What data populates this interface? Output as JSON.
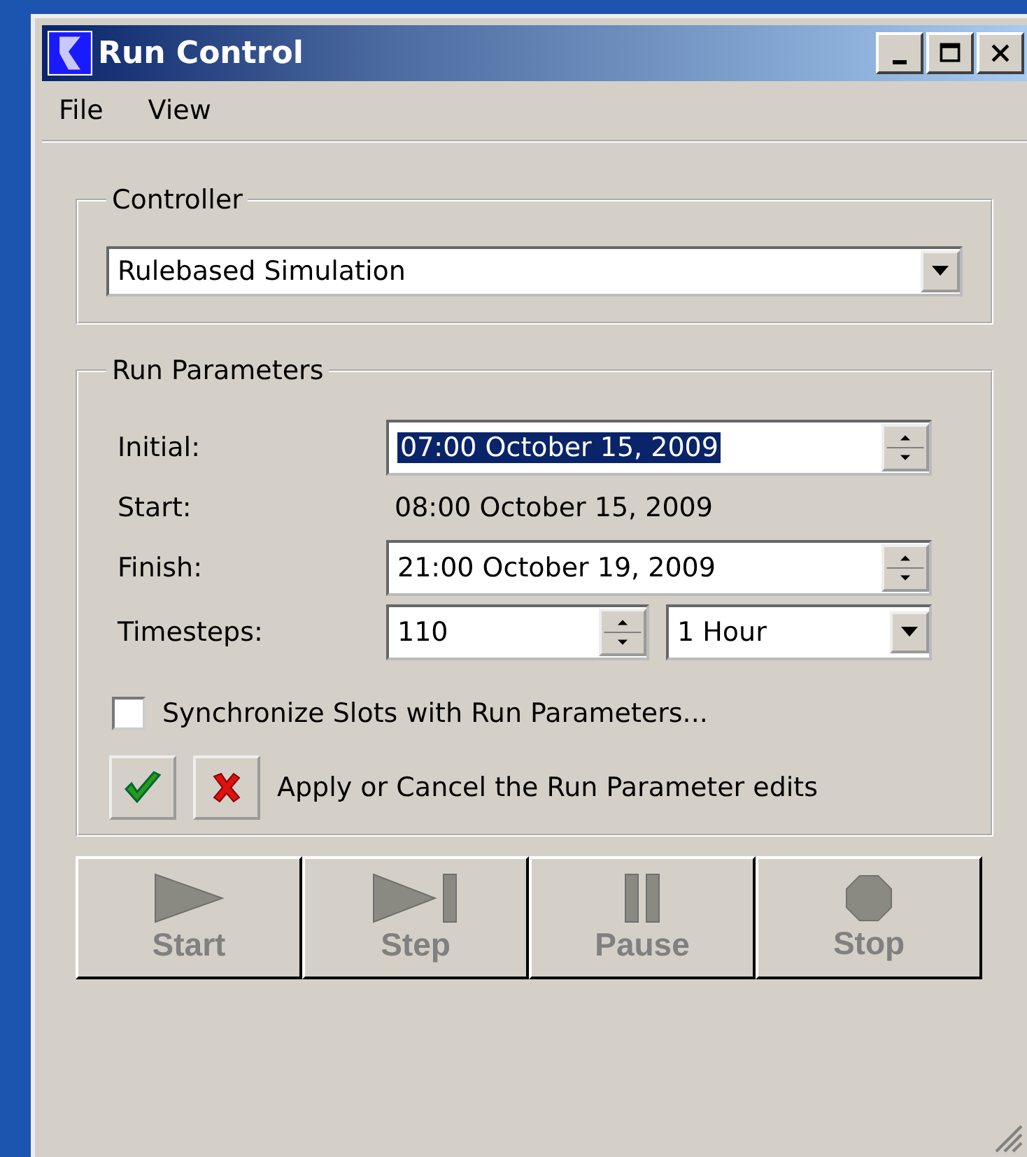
{
  "window": {
    "title": "Run Control"
  },
  "menu": [
    "File",
    "View"
  ],
  "controller": {
    "label": "Controller",
    "value": "Rulebased Simulation"
  },
  "run_parameters": {
    "label": "Run Parameters",
    "fields": [
      {
        "kind": "spin",
        "label": "Initial:",
        "value": "07:00 October 15, 2009",
        "selected": true
      },
      {
        "kind": "text",
        "label": "Start:",
        "value": "08:00 October 15, 2009"
      },
      {
        "kind": "spin",
        "label": "Finish:",
        "value": "21:00 October 19, 2009",
        "selected": false
      }
    ],
    "timesteps": {
      "label": "Timesteps:",
      "value": "110",
      "unit": "1 Hour"
    },
    "sync": {
      "label": "Synchronize Slots with Run Parameters...",
      "checked": false
    },
    "apply_text": "Apply or Cancel the Run Parameter edits"
  },
  "run_buttons": [
    {
      "kind": "start",
      "label": "Start",
      "disabled": true
    },
    {
      "kind": "step",
      "label": "Step",
      "disabled": true
    },
    {
      "kind": "pause",
      "label": "Pause",
      "disabled": true
    },
    {
      "kind": "stop",
      "label": "Stop",
      "disabled": true
    }
  ]
}
